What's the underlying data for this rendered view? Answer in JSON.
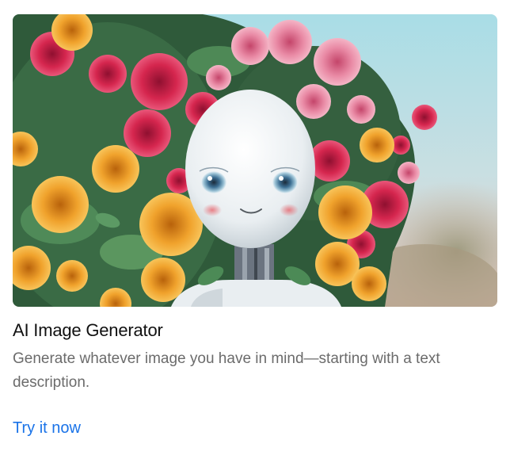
{
  "card": {
    "title": "AI Image Generator",
    "description": "Generate whatever image you have in mind—starting with a text description.",
    "cta_label": "Try it now"
  },
  "colors": {
    "title": "#111111",
    "description": "#6b6b6b",
    "link": "#1a73e8"
  }
}
